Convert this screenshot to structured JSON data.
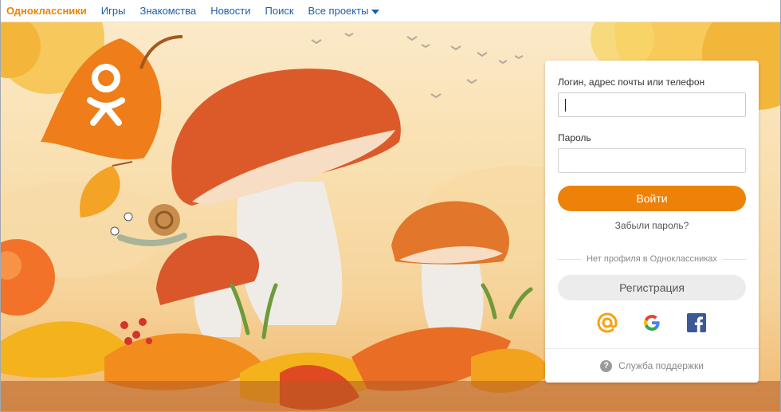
{
  "nav": {
    "brand": "Одноклассники",
    "links": [
      "Игры",
      "Знакомства",
      "Новости",
      "Поиск",
      "Все проекты"
    ]
  },
  "login_form": {
    "login_label": "Логин, адрес почты или телефон",
    "login_value": "",
    "password_label": "Пароль",
    "password_value": "",
    "submit_label": "Войти",
    "forgot_label": "Забыли пароль?",
    "no_profile_label": "Нет профиля в Одноклассниках",
    "register_label": "Регистрация",
    "socials": [
      "mail-ru-icon",
      "google-icon",
      "facebook-icon"
    ],
    "support_label": "Служба поддержки"
  },
  "colors": {
    "brand_orange": "#ee8208",
    "link_blue": "#1e5fa6",
    "facebook_blue": "#3b5998"
  }
}
